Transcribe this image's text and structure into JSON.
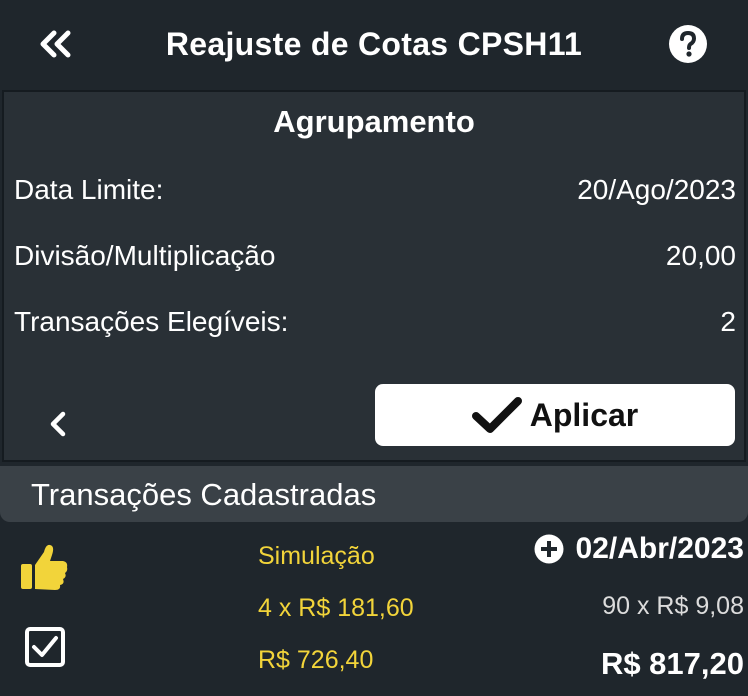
{
  "header": {
    "title": "Reajuste de Cotas CPSH11"
  },
  "panel": {
    "title": "Agrupamento",
    "rows": [
      {
        "label": "Data Limite:",
        "value": "20/Ago/2023"
      },
      {
        "label": "Divisão/Multiplicação",
        "value": "20,00"
      },
      {
        "label": "Transações Elegíveis:",
        "value": "2"
      }
    ],
    "apply_label": "Aplicar"
  },
  "section": {
    "title": "Transações Cadastradas"
  },
  "transaction": {
    "type": "Simulação",
    "qty_price": "4 x R$ 181,60",
    "subtotal": "R$ 726,40",
    "date": "02/Abr/2023",
    "right_qty_price": "90 x R$ 9,08",
    "total": "R$ 817,20"
  },
  "colors": {
    "background": "#1f262c",
    "panel": "#293036",
    "accent_yellow": "#f2d43a",
    "button_bg": "#ffffff"
  },
  "icons": {
    "back": "double-chevron-left-icon",
    "help": "question-circle-icon",
    "prev": "chevron-left-icon",
    "apply": "checkmark-icon",
    "thumb": "thumbs-up-icon",
    "checkbox": "checked-box-icon",
    "add": "plus-circle-icon"
  }
}
